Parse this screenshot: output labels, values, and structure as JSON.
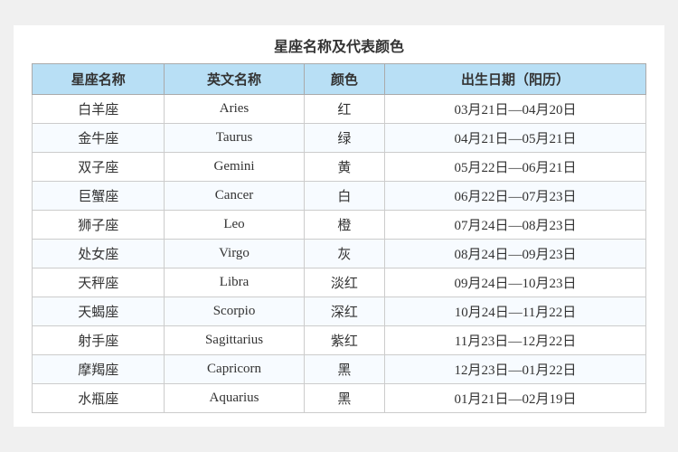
{
  "title": "星座名称及代表颜色",
  "headers": [
    "星座名称",
    "英文名称",
    "颜色",
    "出生日期（阳历）"
  ],
  "rows": [
    {
      "chinese": "白羊座",
      "english": "Aries",
      "color": "红",
      "dates": "03月21日—04月20日"
    },
    {
      "chinese": "金牛座",
      "english": "Taurus",
      "color": "绿",
      "dates": "04月21日—05月21日"
    },
    {
      "chinese": "双子座",
      "english": "Gemini",
      "color": "黄",
      "dates": "05月22日—06月21日"
    },
    {
      "chinese": "巨蟹座",
      "english": "Cancer",
      "color": "白",
      "dates": "06月22日—07月23日"
    },
    {
      "chinese": "狮子座",
      "english": "Leo",
      "color": "橙",
      "dates": "07月24日—08月23日"
    },
    {
      "chinese": "处女座",
      "english": "Virgo",
      "color": "灰",
      "dates": "08月24日—09月23日"
    },
    {
      "chinese": "天秤座",
      "english": "Libra",
      "color": "淡红",
      "dates": "09月24日—10月23日"
    },
    {
      "chinese": "天蝎座",
      "english": "Scorpio",
      "color": "深红",
      "dates": "10月24日—11月22日"
    },
    {
      "chinese": "射手座",
      "english": "Sagittarius",
      "color": "紫红",
      "dates": "11月23日—12月22日"
    },
    {
      "chinese": "摩羯座",
      "english": "Capricorn",
      "color": "黑",
      "dates": "12月23日—01月22日"
    },
    {
      "chinese": "水瓶座",
      "english": "Aquarius",
      "color": "黑",
      "dates": "01月21日—02月19日"
    }
  ]
}
